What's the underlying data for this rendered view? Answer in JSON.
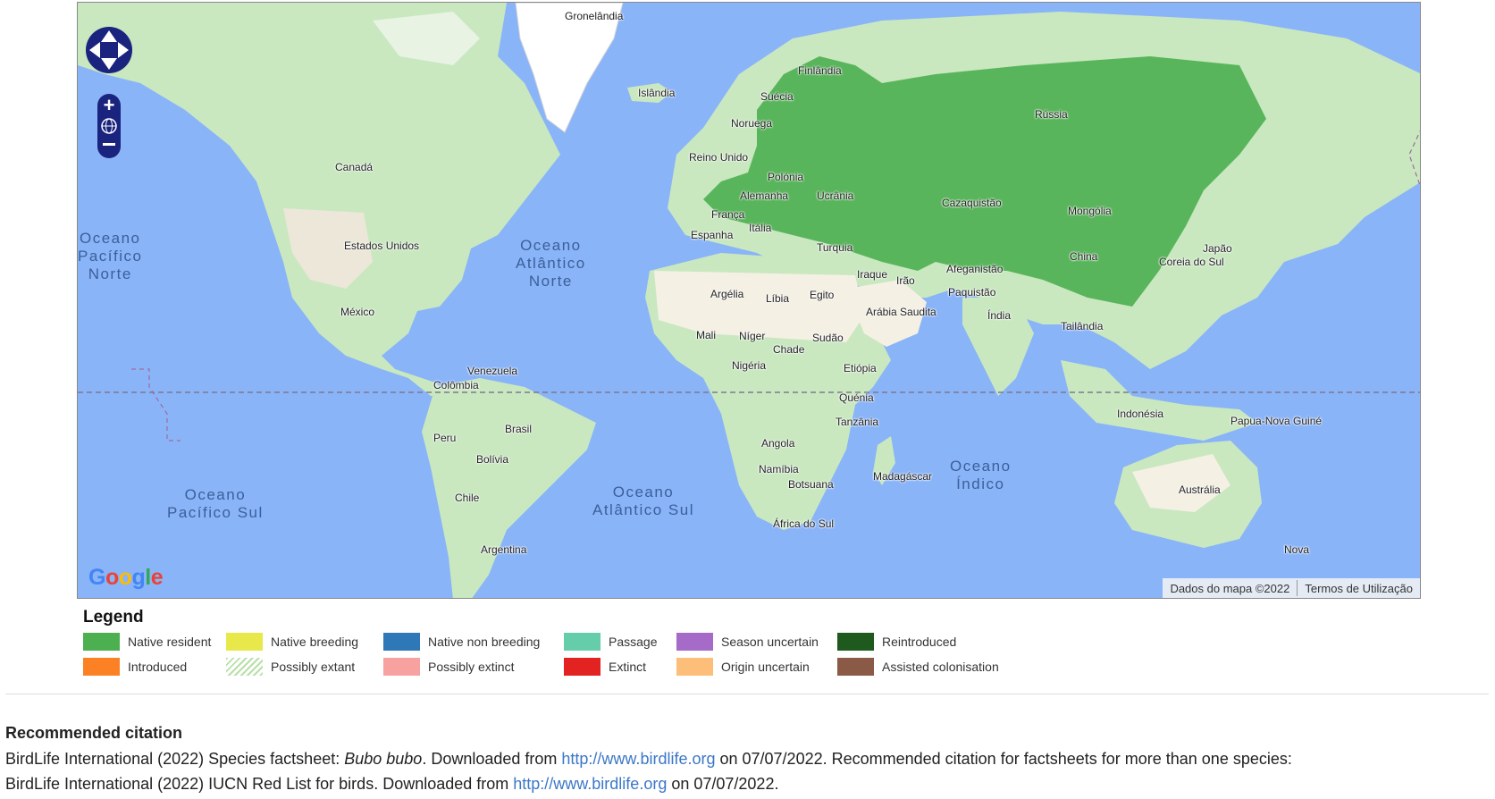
{
  "map": {
    "colors": {
      "ocean": "#8ab4f8",
      "land": "#c9e8c0",
      "desert": "#f5f0e4",
      "ice": "#ffffff",
      "range": "#4caf50"
    },
    "countries": [
      "Gronelândia",
      "Islândia",
      "Finlândia",
      "Suécia",
      "Noruega",
      "Rússia",
      "Reino Unido",
      "Polónia",
      "Alemanha",
      "Ucrânia",
      "França",
      "Itália",
      "Espanha",
      "Turquia",
      "Cazaquistão",
      "Mongólia",
      "Canadá",
      "Estados Unidos",
      "México",
      "Argélia",
      "Líbia",
      "Egito",
      "Iraque",
      "Irão",
      "Afeganistão",
      "Paquistão",
      "Arábia Saudita",
      "China",
      "Coreia do Sul",
      "Japão",
      "Índia",
      "Tailândia",
      "Mali",
      "Níger",
      "Chade",
      "Sudão",
      "Nigéria",
      "Etiópia",
      "Quénia",
      "Tanzânia",
      "Venezuela",
      "Colômbia",
      "Brasil",
      "Peru",
      "Bolívia",
      "Chile",
      "Argentina",
      "Angola",
      "Namíbia",
      "Botsuana",
      "Madagáscar",
      "África do Sul",
      "Indonésia",
      "Papua-Nova Guiné",
      "Austrália",
      "Nova"
    ],
    "oceans": [
      "Oceano Pacífico Norte",
      "Oceano Atlântico Norte",
      "Oceano Pacífico Sul",
      "Oceano Atlântico Sul",
      "Oceano Índico"
    ],
    "logo": "Google",
    "credit_data": "Dados do mapa ©2022",
    "credit_terms": "Termos de Utilização",
    "controls": [
      "pan-up-icon",
      "pan-left-icon",
      "pan-right-icon",
      "pan-down-icon",
      "zoom-in-icon",
      "globe-icon",
      "zoom-out-icon"
    ]
  },
  "legend": {
    "title": "Legend",
    "items": [
      {
        "label": "Native resident",
        "color": "#4caf50"
      },
      {
        "label": "Native breeding",
        "color": "#e8e84a"
      },
      {
        "label": "Native non breeding",
        "color": "#2e78b7"
      },
      {
        "label": "Passage",
        "color": "#66cdaa"
      },
      {
        "label": "Season uncertain",
        "color": "#a66bc9"
      },
      {
        "label": "Reintroduced",
        "color": "#1e5a1e"
      },
      {
        "label": "Introduced",
        "color": "#fb8124"
      },
      {
        "label": "Possibly extant",
        "color": "hatched-green"
      },
      {
        "label": "Possibly extinct",
        "color": "#f7a1a1"
      },
      {
        "label": "Extinct",
        "color": "#e32222"
      },
      {
        "label": "Origin uncertain",
        "color": "#fdbe79"
      },
      {
        "label": "Assisted colonisation",
        "color": "#8b5a46"
      }
    ]
  },
  "citation": {
    "title": "Recommended citation",
    "line1_a": "BirdLife International (2022) Species factsheet: ",
    "line1_species": "Bubo bubo",
    "line1_b": ". Downloaded from ",
    "link": "http://www.birdlife.org",
    "line1_c": " on 07/07/2022. Recommended citation for factsheets for more than one species:",
    "line2_a": "BirdLife International (2022) IUCN Red List for birds. Downloaded from ",
    "line2_c": " on 07/07/2022."
  }
}
